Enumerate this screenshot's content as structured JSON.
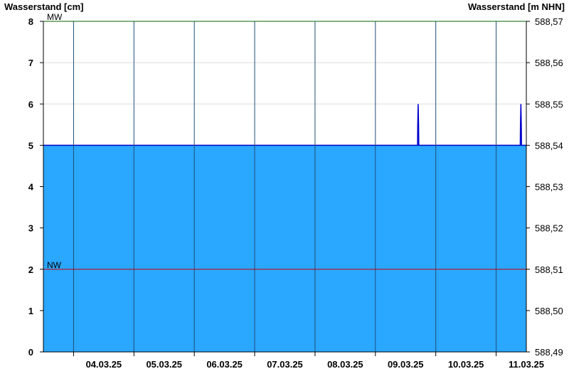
{
  "chart_data": {
    "type": "area",
    "left_axis_title": "Wasserstand [cm]",
    "right_axis_title": "Wasserstand [m NHN]",
    "ylim": [
      0,
      8
    ],
    "y_ticks": [
      0,
      1,
      2,
      3,
      4,
      5,
      6,
      7,
      8
    ],
    "right_y_tick_labels": [
      "588,49",
      "588,50",
      "588,51",
      "588,52",
      "588,53",
      "588,54",
      "588,55",
      "588,56",
      "588,57"
    ],
    "x_range": [
      "2025-03-03T12:00",
      "2025-03-11T12:00"
    ],
    "x_tick_labels": [
      "04.03.25",
      "05.03.25",
      "06.03.25",
      "07.03.25",
      "08.03.25",
      "09.03.25",
      "10.03.25",
      "11.03.25"
    ],
    "day_boundaries": [
      "2025-03-04T00:00",
      "2025-03-05T00:00",
      "2025-03-06T00:00",
      "2025-03-07T00:00",
      "2025-03-08T00:00",
      "2025-03-09T00:00",
      "2025-03-10T00:00",
      "2025-03-11T00:00"
    ],
    "series": [
      {
        "points": [
          [
            "2025-03-03T12:00",
            5
          ],
          [
            "2025-03-09T16:45",
            5
          ],
          [
            "2025-03-09T16:50",
            5.5
          ],
          [
            "2025-03-09T17:00",
            6
          ],
          [
            "2025-03-09T17:10",
            5.5
          ],
          [
            "2025-03-09T17:15",
            5
          ],
          [
            "2025-03-11T09:35",
            5
          ],
          [
            "2025-03-11T09:40",
            5.5
          ],
          [
            "2025-03-11T09:50",
            6
          ],
          [
            "2025-03-11T10:00",
            5.5
          ],
          [
            "2025-03-11T10:05",
            5
          ],
          [
            "2025-03-11T12:00",
            5
          ]
        ],
        "fill_color": "#2aa7ff",
        "line_color": "#0000cc"
      }
    ],
    "reference_lines": [
      {
        "label": "MW",
        "value": 8,
        "color": "#006600"
      },
      {
        "label": "NW",
        "value": 2,
        "color": "#cc0000"
      }
    ],
    "grid": true
  }
}
